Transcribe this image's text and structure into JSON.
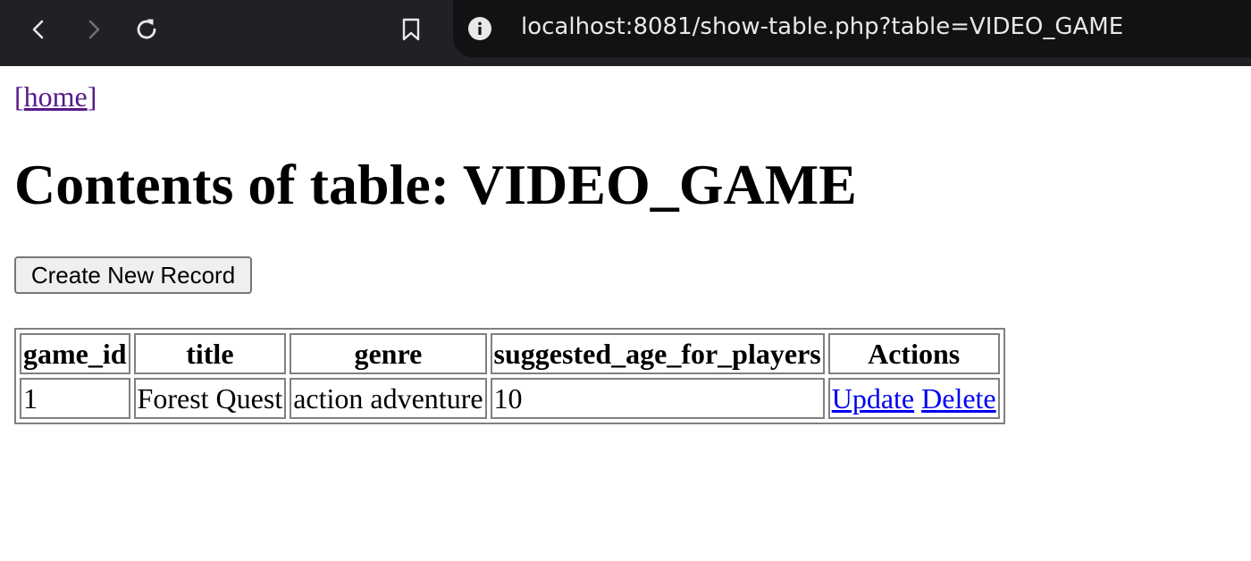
{
  "browser": {
    "url": "localhost:8081/show-table.php?table=VIDEO_GAME",
    "icons": [
      "back-arrow-icon",
      "forward-arrow-icon",
      "reload-icon",
      "bookmark-icon",
      "info-icon"
    ]
  },
  "nav": {
    "open_bracket": "[",
    "home_label": "home",
    "close_bracket": "]"
  },
  "page": {
    "title": "Contents of table: VIDEO_GAME",
    "create_button": "Create New Record"
  },
  "table": {
    "columns": [
      "game_id",
      "title",
      "genre",
      "suggested_age_for_players",
      "Actions"
    ],
    "rows": [
      {
        "game_id": "1",
        "title": "Forest Quest",
        "genre": "action adventure",
        "suggested_age_for_players": "10",
        "update_label": "Update",
        "delete_label": "Delete"
      }
    ]
  },
  "colors": {
    "toolbar_bg": "#202124",
    "url_bg": "#111214",
    "visited_link": "#551a8b",
    "link": "#0000ee"
  }
}
